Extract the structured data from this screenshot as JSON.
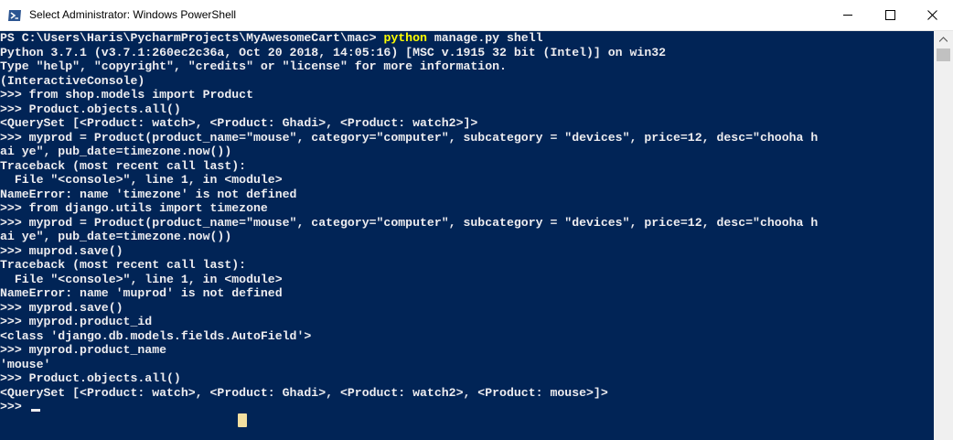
{
  "window": {
    "title": "Select Administrator: Windows PowerShell",
    "controls": {
      "minimize_icon": "minimize-icon",
      "maximize_icon": "maximize-icon",
      "close_icon": "close-icon"
    }
  },
  "colors": {
    "console_background": "#012456",
    "console_text": "#eeedf0",
    "command_highlight": "#ffff00"
  },
  "console": {
    "first_line": {
      "prompt": "PS C:\\Users\\Haris\\PycharmProjects\\MyAwesomeCart\\mac> ",
      "command": "python",
      "args": " manage.py shell"
    },
    "lines": [
      "Python 3.7.1 (v3.7.1:260ec2c36a, Oct 20 2018, 14:05:16) [MSC v.1915 32 bit (Intel)] on win32",
      "Type \"help\", \"copyright\", \"credits\" or \"license\" for more information.",
      "(InteractiveConsole)",
      ">>> from shop.models import Product",
      ">>> Product.objects.all()",
      "<QuerySet [<Product: watch>, <Product: Ghadi>, <Product: watch2>]>",
      ">>> myprod = Product(product_name=\"mouse\", category=\"computer\", subcategory = \"devices\", price=12, desc=\"chooha h",
      "ai ye\", pub_date=timezone.now())",
      "Traceback (most recent call last):",
      "  File \"<console>\", line 1, in <module>",
      "NameError: name 'timezone' is not defined",
      ">>> from django.utils import timezone",
      ">>> myprod = Product(product_name=\"mouse\", category=\"computer\", subcategory = \"devices\", price=12, desc=\"chooha h",
      "ai ye\", pub_date=timezone.now())",
      ">>> muprod.save()",
      "Traceback (most recent call last):",
      "  File \"<console>\", line 1, in <module>",
      "NameError: name 'muprod' is not defined",
      ">>> myprod.save()",
      ">>> myprod.product_id",
      "<class 'django.db.models.fields.AutoField'>",
      ">>> myprod.product_name",
      "'mouse'",
      ">>> Product.objects.all()",
      "<QuerySet [<Product: watch>, <Product: Ghadi>, <Product: watch2>, <Product: mouse>]>"
    ],
    "current_prompt": ">>> "
  }
}
